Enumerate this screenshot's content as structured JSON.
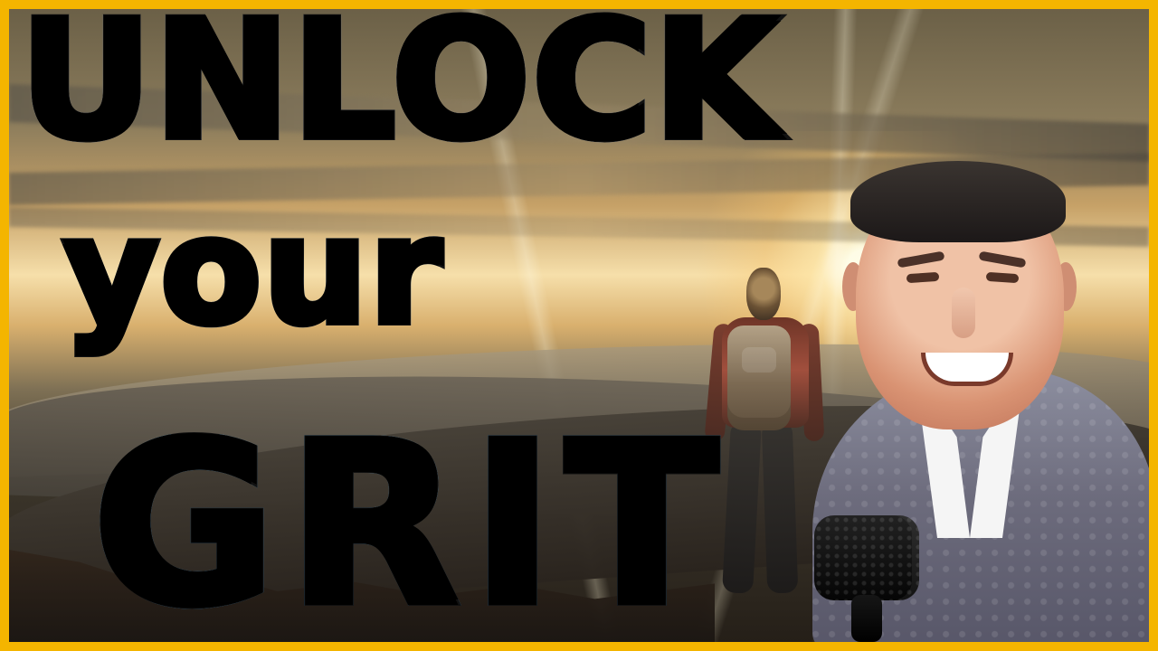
{
  "thumbnail": {
    "title_top": "UNLOCK",
    "title_middle": "your",
    "title_bottom": "GRIT"
  },
  "colors": {
    "frame": "#f4b500",
    "top_text": "#e9f4ff",
    "middle_text": "#a7d9ff",
    "bottom_text": "#67b6f0",
    "outline": "#111111"
  },
  "scene": {
    "background_theme": "sunset-mountain",
    "hiker_icon": "hiker-with-backpack",
    "presenter_icon": "smiling-man",
    "microphone_icon": "microphone"
  }
}
